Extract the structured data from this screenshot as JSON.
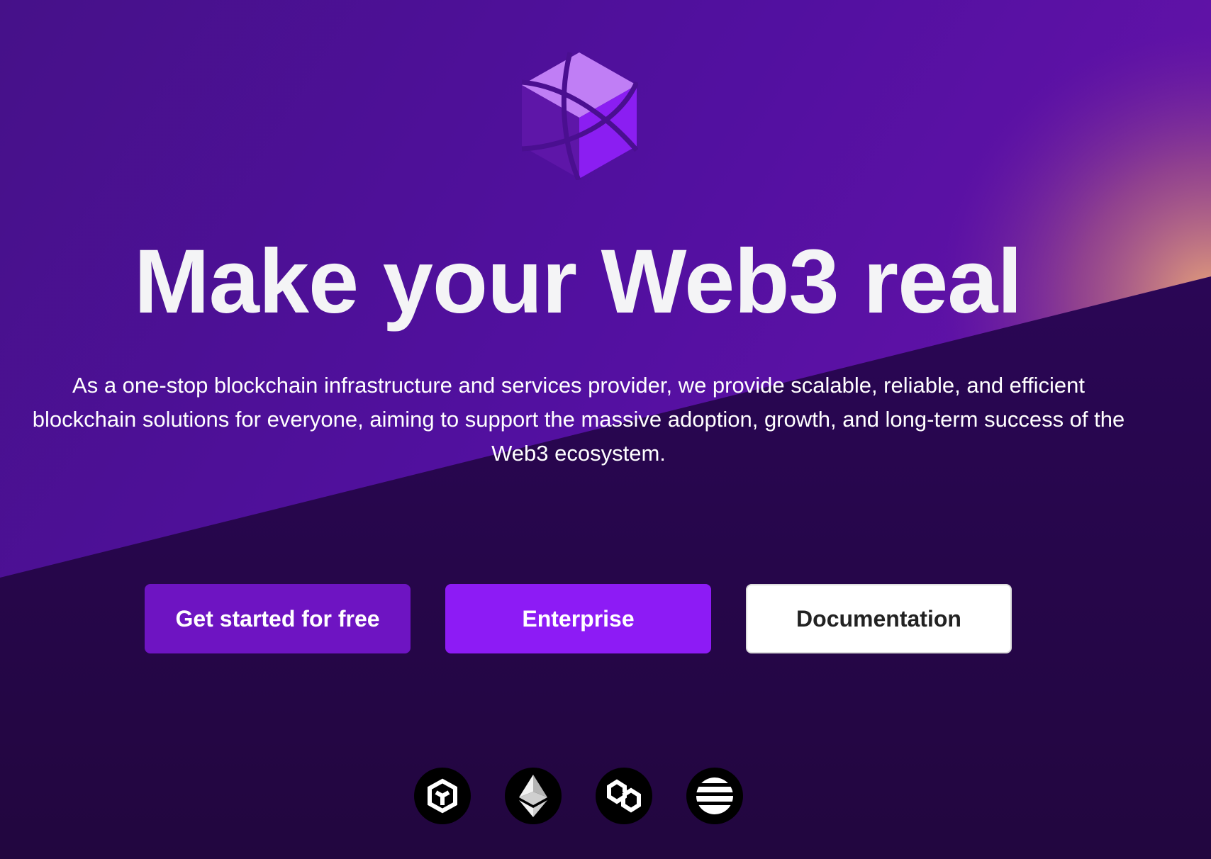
{
  "hero": {
    "title": "Make your Web3 real",
    "description": "As a one-stop blockchain infrastructure and services provider, we provide scalable, reliable, and efficient blockchain solutions for everyone, aiming to support the massive adoption, growth, and long-term success of the Web3 ecosystem."
  },
  "buttons": {
    "get_started": "Get started for free",
    "enterprise": "Enterprise",
    "documentation": "Documentation"
  },
  "chains": [
    {
      "icon": "bnb-chain-icon"
    },
    {
      "icon": "ethereum-icon"
    },
    {
      "icon": "polygon-icon"
    },
    {
      "icon": "aptos-icon"
    }
  ],
  "colors": {
    "background_dark": "#24064a",
    "background_light": "#4a0f90",
    "accent_primary": "#6e14c2",
    "accent_enterprise": "#8d1bf5",
    "glow": "#e09a7a"
  }
}
